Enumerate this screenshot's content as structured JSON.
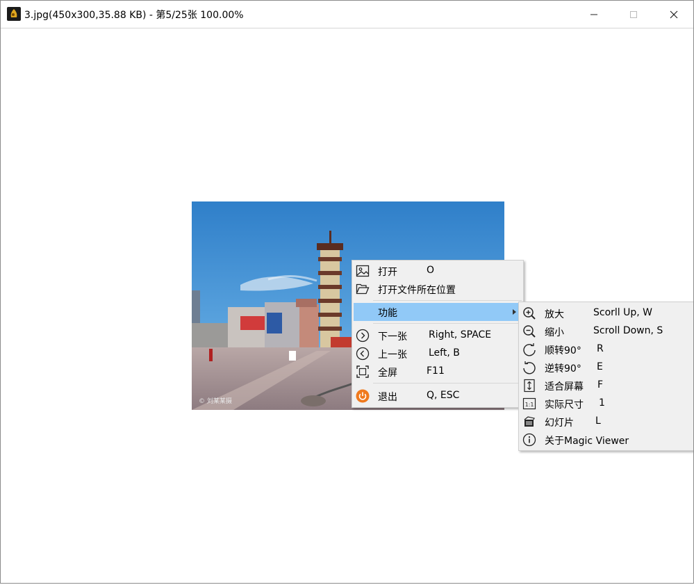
{
  "window": {
    "title": "3.jpg(450x300,35.88 KB) - 第5/25张 100.00%",
    "controls": [
      "minimize",
      "maximize",
      "close"
    ]
  },
  "image": {
    "watermark": "© 刘某某摄"
  },
  "context_menu": {
    "items": [
      {
        "icon": "image-icon",
        "label": "打开",
        "shortcut": "O"
      },
      {
        "icon": "folder-open-icon",
        "label": "打开文件所在位置",
        "shortcut": ""
      },
      {
        "icon": "",
        "label": "功能",
        "shortcut": "",
        "has_submenu": true,
        "highlighted": true
      },
      {
        "icon": "chevron-right-circle-icon",
        "label": "下一张",
        "shortcut": "Right, SPACE"
      },
      {
        "icon": "chevron-left-circle-icon",
        "label": "上一张",
        "shortcut": "Left, B"
      },
      {
        "icon": "fullscreen-icon",
        "label": "全屏",
        "shortcut": "F11"
      },
      {
        "icon": "power-icon",
        "label": "退出",
        "shortcut": "Q, ESC"
      }
    ]
  },
  "submenu": {
    "items": [
      {
        "icon": "zoom-in-icon",
        "label": "放大",
        "shortcut": "Scorll Up, W"
      },
      {
        "icon": "zoom-out-icon",
        "label": "缩小",
        "shortcut": "Scroll Down, S"
      },
      {
        "icon": "rotate-clockwise-icon",
        "label": "顺转90°",
        "shortcut": "R"
      },
      {
        "icon": "rotate-counterclockwise-icon",
        "label": "逆转90°",
        "shortcut": "E"
      },
      {
        "icon": "fit-screen-icon",
        "label": "适合屏幕",
        "shortcut": "F"
      },
      {
        "icon": "actual-size-icon",
        "label": "实际尺寸",
        "shortcut": "1"
      },
      {
        "icon": "slideshow-icon",
        "label": "幻灯片",
        "shortcut": "L"
      },
      {
        "icon": "info-icon",
        "label": "关于Magic Viewer",
        "shortcut": ""
      }
    ]
  },
  "colors": {
    "menu_bg": "#f0f0f0",
    "highlight": "#91c9f7",
    "power_icon": "#f07a1e"
  }
}
